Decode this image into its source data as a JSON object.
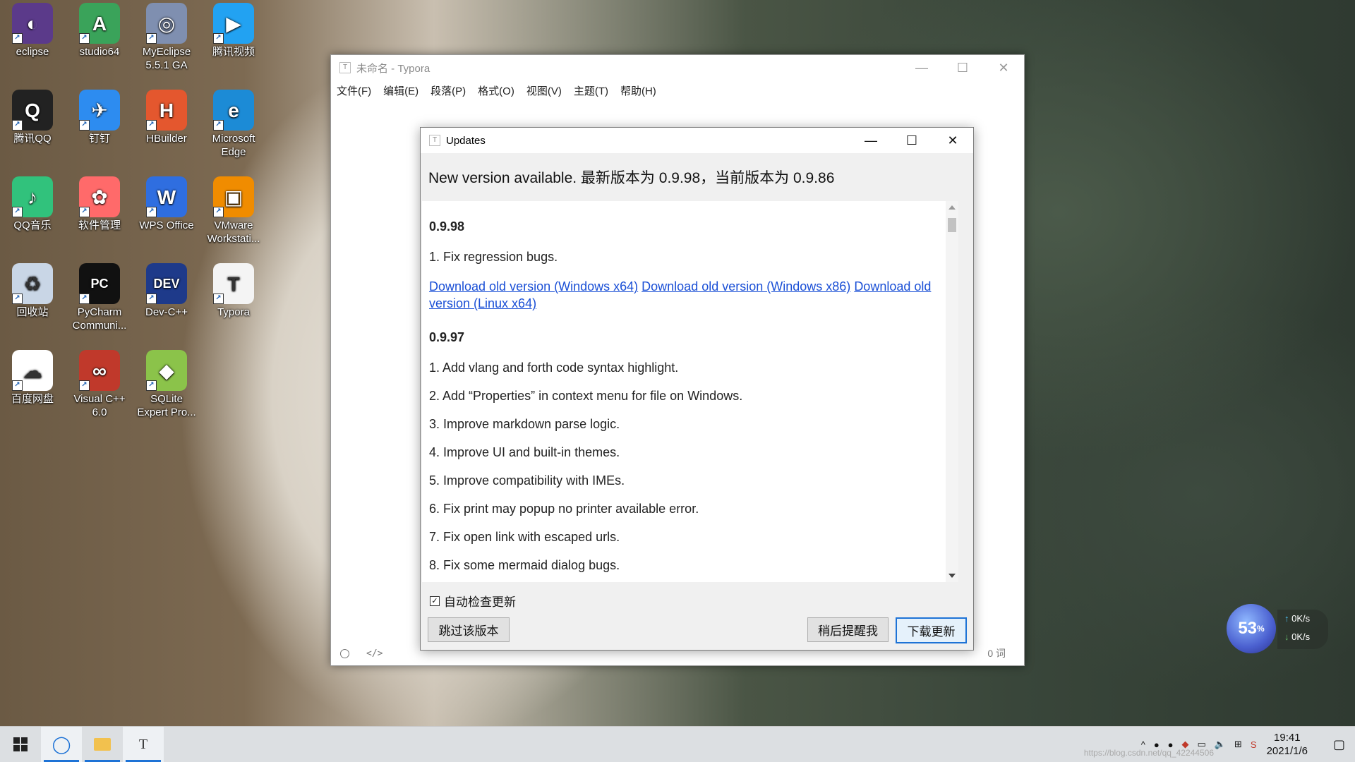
{
  "desktop": {
    "icons": [
      {
        "label": "eclipse",
        "color": "#5b3a8a",
        "glyph": "◐"
      },
      {
        "label": "studio64",
        "color": "#3aa35a",
        "glyph": "A"
      },
      {
        "label": "MyEclipse 5.5.1 GA",
        "color": "#7f8fb0",
        "glyph": "◎"
      },
      {
        "label": "腾讯视频",
        "color": "#22a2f2",
        "glyph": "▶"
      },
      {
        "label": "腾讯QQ",
        "color": "#222222",
        "glyph": "Q"
      },
      {
        "label": "钉钉",
        "color": "#2d8cf0",
        "glyph": "✈"
      },
      {
        "label": "HBuilder",
        "color": "#e4572e",
        "glyph": "H"
      },
      {
        "label": "Microsoft Edge",
        "color": "#1c8bd6",
        "glyph": "e"
      },
      {
        "label": "QQ音乐",
        "color": "#31c27c",
        "glyph": "♪"
      },
      {
        "label": "软件管理",
        "color": "#ff6a6a",
        "glyph": "✿"
      },
      {
        "label": "WPS Office",
        "color": "#2f6ee0",
        "glyph": "W"
      },
      {
        "label": "VMware Workstati...",
        "color": "#f08c00",
        "glyph": "▣"
      },
      {
        "label": "回收站",
        "color": "#c9d6e6",
        "glyph": "♻"
      },
      {
        "label": "PyCharm Communi...",
        "color": "#111111",
        "glyph": "PC"
      },
      {
        "label": "Dev-C++",
        "color": "#1e3a8a",
        "glyph": "DEV"
      },
      {
        "label": "Typora",
        "color": "#f4f4f4",
        "glyph": "T"
      },
      {
        "label": "百度网盘",
        "color": "#ffffff",
        "glyph": "☁"
      },
      {
        "label": "Visual C++ 6.0",
        "color": "#c0392b",
        "glyph": "∞"
      },
      {
        "label": "SQLite Expert Pro...",
        "color": "#8bc34a",
        "glyph": "◆"
      }
    ]
  },
  "typora": {
    "title": "未命名 - Typora",
    "menu": [
      "文件(F)",
      "编辑(E)",
      "段落(P)",
      "格式(O)",
      "视图(V)",
      "主题(T)",
      "帮助(H)"
    ],
    "status_code_icon": "</>",
    "word_count": "0 词"
  },
  "updates": {
    "title": "Updates",
    "headline": "New version available. 最新版本为 0.9.98，当前版本为 0.9.86",
    "v1": {
      "version": "0.9.98",
      "items": [
        "1. Fix regression bugs."
      ],
      "links": [
        "Download old version (Windows x64)",
        "Download old version (Windows x86)",
        "Download old version (Linux x64)"
      ]
    },
    "v2": {
      "version": "0.9.97",
      "items": [
        "1. Add vlang and forth code syntax highlight.",
        "2. Add “Properties” in context menu for file on Windows.",
        "3. Improve markdown parse logic.",
        "4. Improve UI and built-in themes.",
        "5. Improve compatibility with IMEs.",
        "6. Fix print may popup no printer available error.",
        "7. Fix open link with escaped urls.",
        "8. Fix some mermaid dialog bugs."
      ]
    },
    "auto_check_label": "自动检查更新",
    "auto_check_checked": true,
    "skip_label": "跳过该版本",
    "later_label": "稍后提醒我",
    "download_label": "下载更新"
  },
  "speed_widget": {
    "percent": "53",
    "up": "0K/s",
    "down": "0K/s"
  },
  "taskbar": {
    "time": "19:41",
    "date": "2021/1/6",
    "watermark": "https://blog.csdn.net/qq_42244506"
  }
}
